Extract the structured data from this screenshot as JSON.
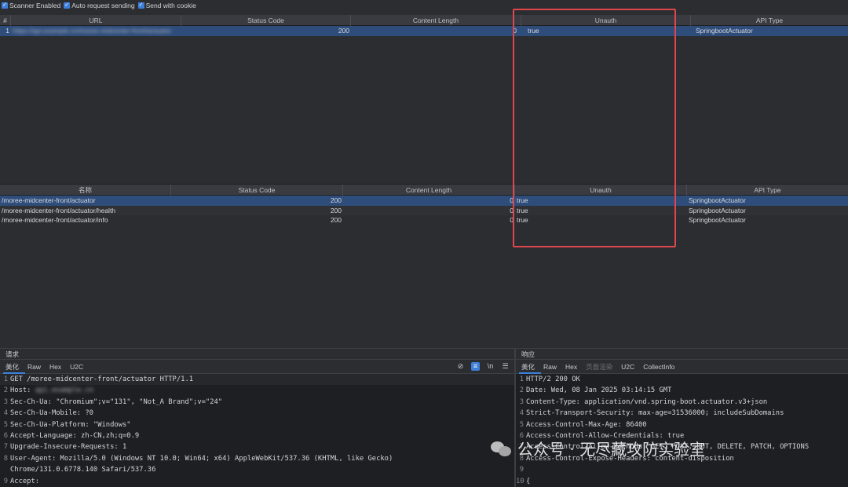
{
  "toolbar": {
    "items": [
      {
        "label": "Scanner Enabled",
        "checked": true
      },
      {
        "label": "Auto request sending",
        "checked": true
      },
      {
        "label": "Send with cookie",
        "checked": true
      }
    ]
  },
  "table1": {
    "columns": [
      "#",
      "URL",
      "Status Code",
      "Content Length",
      "Unauth",
      "API Type"
    ],
    "rows": [
      {
        "num": "1",
        "url": "https://api.example.cn/moree-midcenter-front/actuator",
        "status": "200",
        "length": "0",
        "unauth": "true",
        "api_type": "SpringbootActuator"
      }
    ]
  },
  "table2": {
    "columns": [
      "名称",
      "Status Code",
      "Content Length",
      "Unauth",
      "API Type"
    ],
    "rows": [
      {
        "name": "/moree-midcenter-front/actuator",
        "status": "200",
        "length": "0",
        "unauth": "true",
        "api_type": "SpringbootActuator"
      },
      {
        "name": "/moree-midcenter-front/actuator/health",
        "status": "200",
        "length": "0",
        "unauth": "true",
        "api_type": "SpringbootActuator"
      },
      {
        "name": "/moree-midcenter-front/actuator/info",
        "status": "200",
        "length": "0",
        "unauth": "true",
        "api_type": "SpringbootActuator"
      }
    ]
  },
  "request": {
    "title": "请求",
    "tabs": [
      "美化",
      "Raw",
      "Hex",
      "U2C"
    ],
    "lines": [
      {
        "n": "1",
        "t": "GET /moree-midcenter-front/actuator HTTP/1.1"
      },
      {
        "n": "2",
        "t": "Host: "
      },
      {
        "n": "3",
        "t": "Sec-Ch-Ua: \"Chromium\";v=\"131\", \"Not_A Brand\";v=\"24\""
      },
      {
        "n": "4",
        "t": "Sec-Ch-Ua-Mobile: ?0"
      },
      {
        "n": "5",
        "t": "Sec-Ch-Ua-Platform: \"Windows\""
      },
      {
        "n": "6",
        "t": "Accept-Language: zh-CN,zh;q=0.9"
      },
      {
        "n": "7",
        "t": "Upgrade-Insecure-Requests: 1"
      },
      {
        "n": "8",
        "t": "User-Agent: Mozilla/5.0 (Windows NT 10.0; Win64; x64) AppleWebKit/537.36 (KHTML, like Gecko)"
      },
      {
        "n": "",
        "t": "Chrome/131.0.6778.140 Safari/537.36"
      },
      {
        "n": "9",
        "t": "Accept:"
      }
    ],
    "host_value": "api.example.cn"
  },
  "response": {
    "title": "响应",
    "tabs": [
      "美化",
      "Raw",
      "Hex",
      "页面渲染",
      "U2C",
      "CollectInfo"
    ],
    "lines": [
      {
        "n": "1",
        "t": "HTTP/2 200 OK"
      },
      {
        "n": "2",
        "t": "Date: Wed, 08 Jan 2025 03:14:15 GMT"
      },
      {
        "n": "3",
        "t": "Content-Type: application/vnd.spring-boot.actuator.v3+json"
      },
      {
        "n": "4",
        "t": "Strict-Transport-Security: max-age=31536000; includeSubDomains"
      },
      {
        "n": "5",
        "t": "Access-Control-Max-Age: 86400"
      },
      {
        "n": "6",
        "t": "Access-Control-Allow-Credentials: true"
      },
      {
        "n": "7",
        "t": "Access-Control-Allow-Methods: GET, POST, PUT, DELETE, PATCH, OPTIONS"
      },
      {
        "n": "8",
        "t": "Access-Control-Expose-Headers: content-disposition"
      },
      {
        "n": "9",
        "t": ""
      },
      {
        "n": "10",
        "t": "{"
      }
    ]
  },
  "watermark": {
    "text": "公众号 · 无尽藏攻防实验室"
  },
  "colors": {
    "accent": "#3d7fd9",
    "highlight_box": "#e0464e",
    "selected_row": "#2e4d7b"
  }
}
